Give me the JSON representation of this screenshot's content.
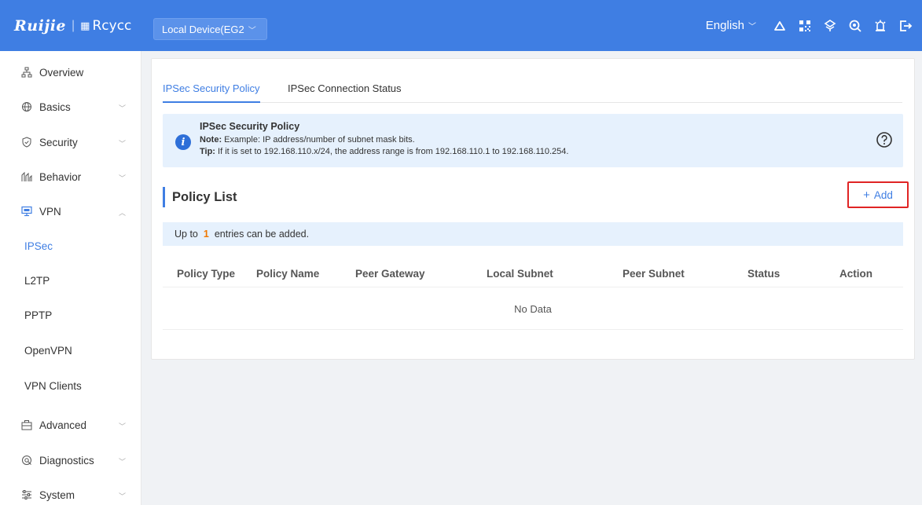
{
  "header": {
    "brand_primary": "Ruijie",
    "brand_separator": "|",
    "brand_secondary": "Rcycc",
    "device_select": "Local Device(EG2",
    "language": "English",
    "icons": [
      "cloud-icon",
      "qr-code-icon",
      "network-icon",
      "search-icon",
      "alert-icon",
      "logout-icon"
    ],
    "color": "#3f7ee3"
  },
  "sidebar": {
    "items": [
      {
        "label": "Overview",
        "icon": "overview-icon"
      },
      {
        "label": "Basics",
        "icon": "globe-icon"
      },
      {
        "label": "Security",
        "icon": "shield-icon"
      },
      {
        "label": "Behavior",
        "icon": "behavior-icon"
      },
      {
        "label": "VPN",
        "icon": "vpn-icon"
      },
      {
        "label": "Advanced",
        "icon": "advanced-icon"
      },
      {
        "label": "Diagnostics",
        "icon": "diagnostics-icon"
      },
      {
        "label": "System",
        "icon": "system-icon"
      }
    ],
    "vpn_sub": [
      "IPSec",
      "L2TP",
      "PPTP",
      "OpenVPN",
      "VPN Clients"
    ]
  },
  "tabs": [
    "IPSec Security Policy",
    "IPSec Connection Status"
  ],
  "info": {
    "title": "IPSec Security Policy",
    "note_label": "Note:",
    "note_text": " Example: IP address/number of subnet mask bits.",
    "tip_label": "Tip:",
    "tip_text": " If it is set to 192.168.110.x/24, the address range is from 192.168.110.1 to 192.168.110.254."
  },
  "policy": {
    "title": "Policy List",
    "add_label": "Add",
    "limit_prefix": "Up to",
    "limit_value": "1",
    "limit_suffix": "entries can be added.",
    "columns": [
      "Policy Type",
      "Policy Name",
      "Peer Gateway",
      "Local Subnet",
      "Peer Subnet",
      "Status",
      "Action"
    ],
    "empty_text": "No Data"
  }
}
